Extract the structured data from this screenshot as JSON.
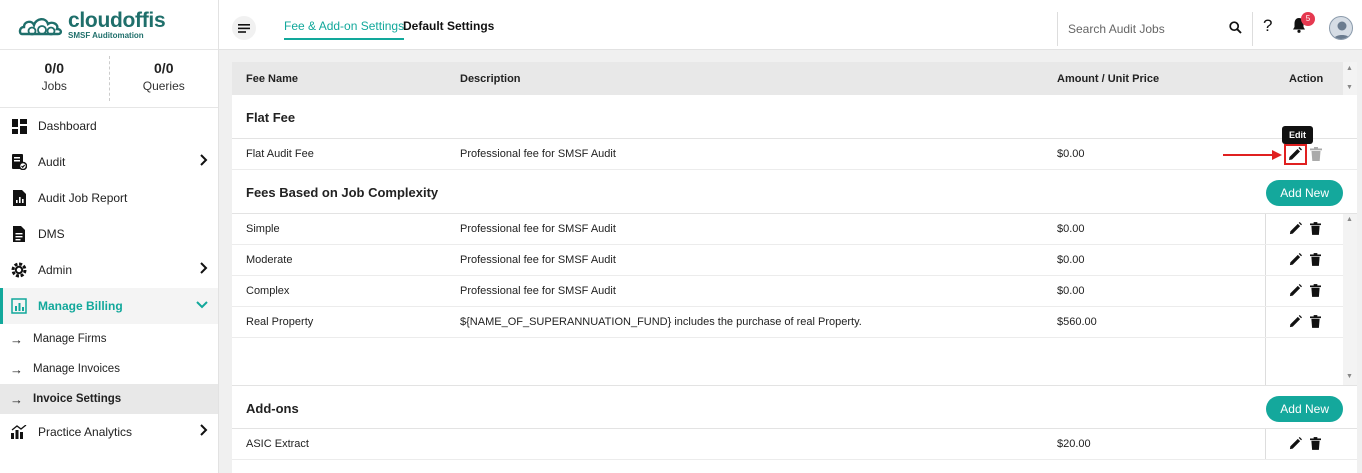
{
  "logo": {
    "brand": "cloudoffis",
    "tagline": "SMSF Auditomation"
  },
  "stats": [
    {
      "value": "0/0",
      "label": "Jobs"
    },
    {
      "value": "0/0",
      "label": "Queries"
    }
  ],
  "nav": {
    "dashboard": "Dashboard",
    "audit": "Audit",
    "audit_job_report": "Audit Job Report",
    "dms": "DMS",
    "admin": "Admin",
    "manage_billing": "Manage Billing",
    "manage_firms": "Manage Firms",
    "manage_invoices": "Manage Invoices",
    "invoice_settings": "Invoice Settings",
    "practice_analytics": "Practice Analytics"
  },
  "tabs": {
    "fee_addon": "Fee & Add-on Settings",
    "default": "Default Settings"
  },
  "search": {
    "placeholder": "Search Audit Jobs"
  },
  "help_glyph": "?",
  "notifications": {
    "count": "5"
  },
  "table_header": {
    "fee_name": "Fee Name",
    "description": "Description",
    "amount": "Amount / Unit Price",
    "action": "Action"
  },
  "flat_fee": {
    "title": "Flat Fee",
    "row": {
      "name": "Flat Audit Fee",
      "description": "Professional fee for SMSF Audit",
      "amount": "$0.00"
    }
  },
  "tooltip": "Edit",
  "complexity": {
    "title": "Fees Based on Job Complexity",
    "add_label": "Add New",
    "rows": [
      {
        "name": "Simple",
        "description": "Professional fee for SMSF Audit",
        "amount": "$0.00"
      },
      {
        "name": "Moderate",
        "description": "Professional fee for SMSF Audit",
        "amount": "$0.00"
      },
      {
        "name": "Complex",
        "description": "Professional fee for SMSF Audit",
        "amount": "$0.00"
      },
      {
        "name": "Real Property",
        "description": "${NAME_OF_SUPERANNUATION_FUND} includes the purchase of real Property.",
        "amount": "$560.00"
      }
    ]
  },
  "addons": {
    "title": "Add-ons",
    "add_label": "Add New",
    "rows": [
      {
        "name": "ASIC Extract",
        "description": "",
        "amount": "$20.00"
      }
    ]
  },
  "colors": {
    "accent": "#12a89b",
    "badge": "#e53950",
    "highlight": "#e02020"
  }
}
